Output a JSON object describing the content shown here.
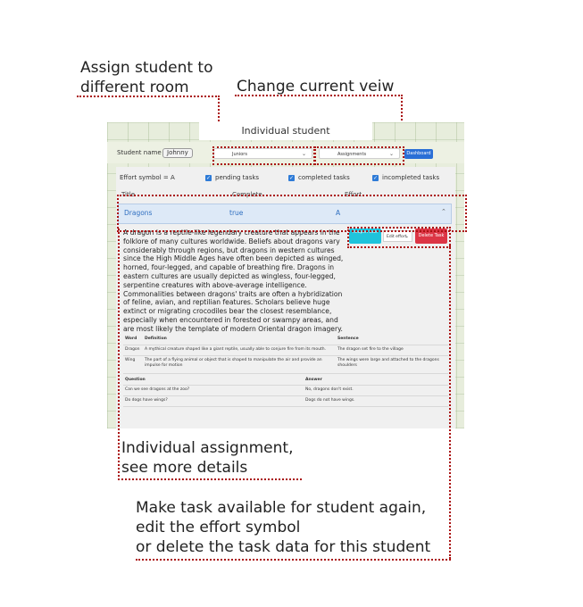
{
  "annotations": {
    "assign_room": [
      "Assign student to",
      "different room"
    ],
    "change_view": "Change current veiw",
    "individual_assignment": [
      "Individual assignment,",
      "see more details"
    ],
    "make_available": [
      "Make task available for student again,",
      "edit the effort symbol",
      "or delete the task data for this student"
    ]
  },
  "app": {
    "title": "Individual student",
    "student_label": "Student name :",
    "student_name": "Johnny",
    "room_select": "Juniors",
    "view_select": "Assignments",
    "dashboard_button": "Dashboard"
  },
  "filters": {
    "effort_symbol": "Effort symbol =  A",
    "pending": "pending tasks",
    "completed": "completed tasks",
    "incompleted": "incompleted tasks"
  },
  "table_headers": [
    "Title",
    "Complete",
    "Effort"
  ],
  "task": {
    "title": "Dragons",
    "complete": "true",
    "effort": "A",
    "description": "A dragon is a reptile-like legendary creature that appears in the folklore of many cultures worldwide. Beliefs about dragons vary considerably through regions, but dragons in western cultures since the High Middle Ages have often been depicted as winged, horned, four-legged, and capable of breathing fire. Dragons in eastern cultures are usually depicted as wingless, four-legged, serpentine creatures with above-average intelligence. Commonalities between dragons' traits are often a hybridization of feline, avian, and reptilian features. Scholars believe huge extinct or migrating crocodiles bear the closest resemblance, especially when encountered in forested or swampy areas, and are most likely the template of modern Oriental dragon imagery."
  },
  "actions": {
    "reopen": "Reopen task",
    "edit_effort": "Edit effort",
    "delete": "Delete Task"
  },
  "word_table": {
    "headers": [
      "Word",
      "Definition",
      "Sentence"
    ],
    "rows": [
      [
        "Dragon",
        "A mythical creature shaped like a giant reptile, usually able to conjure fire from its mouth.",
        "The dragon set fire to the village"
      ],
      [
        "Wing",
        "The part of a flying animal or object that is shaped to manipulate the air and provide an impulse for motion",
        "The wings were large and attached to the dragons shoulders"
      ]
    ]
  },
  "qa_table": {
    "headers": [
      "Question",
      "Answer"
    ],
    "rows": [
      [
        "Can we see dragons at the zoo?",
        "No, dragons don't exist."
      ],
      [
        "Do dogs have wings?",
        "Dogs do not have wings."
      ]
    ]
  }
}
